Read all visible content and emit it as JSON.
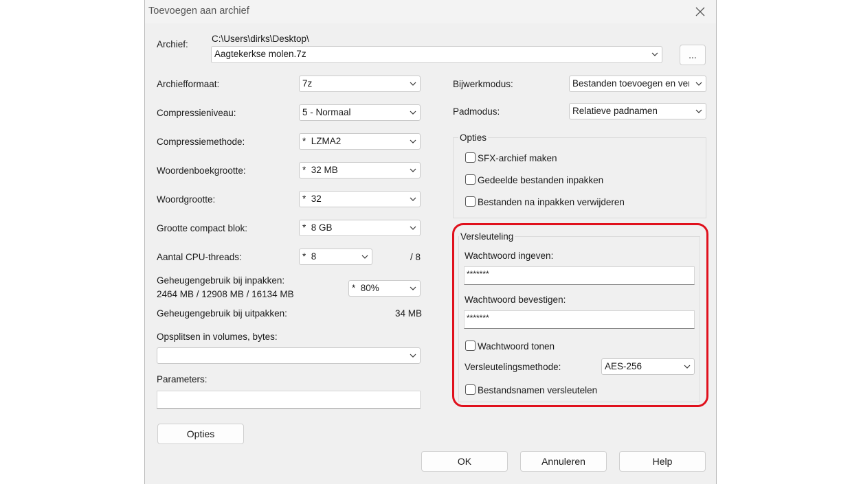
{
  "window": {
    "title": "Toevoegen aan archief"
  },
  "archive": {
    "label": "Archief:",
    "path": "C:\\Users\\dirks\\Desktop\\",
    "filename": "Aagtekerkse molen.7z",
    "browse_label": "..."
  },
  "settings": {
    "format": {
      "label": "Archiefformaat:",
      "value": "7z"
    },
    "level": {
      "label": "Compressieniveau:",
      "value": "5 - Normaal"
    },
    "method": {
      "label": "Compressiemethode:",
      "value": "*  LZMA2"
    },
    "dict": {
      "label": "Woordenboekgrootte:",
      "value": "*  32 MB"
    },
    "word": {
      "label": "Woordgrootte:",
      "value": "*  32"
    },
    "solid": {
      "label": "Grootte compact blok:",
      "value": "*  8 GB"
    },
    "threads": {
      "label": "Aantal CPU-threads:",
      "value": "*  8",
      "max": "/ 8"
    },
    "mem_pack": {
      "label": "Geheugengebruik bij inpakken:",
      "detail": "2464 MB / 12908 MB / 16134 MB",
      "value": "*  80%"
    },
    "mem_unpack": {
      "label": "Geheugengebruik bij uitpakken:",
      "value": "34 MB"
    },
    "split": {
      "label": "Opsplitsen in volumes, bytes:",
      "value": ""
    },
    "params": {
      "label": "Parameters:",
      "value": ""
    },
    "options_button": "Opties"
  },
  "right": {
    "update": {
      "label": "Bijwerkmodus:",
      "value": "Bestanden toevoegen en ver"
    },
    "path_mode": {
      "label": "Padmodus:",
      "value": "Relatieve padnamen"
    },
    "options": {
      "title": "Opties",
      "sfx": "SFX-archief maken",
      "shared": "Gedeelde bestanden inpakken",
      "delete": "Bestanden na inpakken verwijderen"
    },
    "encryption": {
      "title": "Versleuteling",
      "enter_label": "Wachtwoord ingeven:",
      "enter_value": "*******",
      "confirm_label": "Wachtwoord bevestigen:",
      "confirm_value": "*******",
      "show_label": "Wachtwoord tonen",
      "method_label": "Versleutelingsmethode:",
      "method_value": "AES-256",
      "names_label": "Bestandsnamen versleutelen"
    }
  },
  "buttons": {
    "ok": "OK",
    "cancel": "Annuleren",
    "help": "Help"
  },
  "colors": {
    "highlight": "#e0101c",
    "dialog_bg": "#f0f0f0"
  }
}
